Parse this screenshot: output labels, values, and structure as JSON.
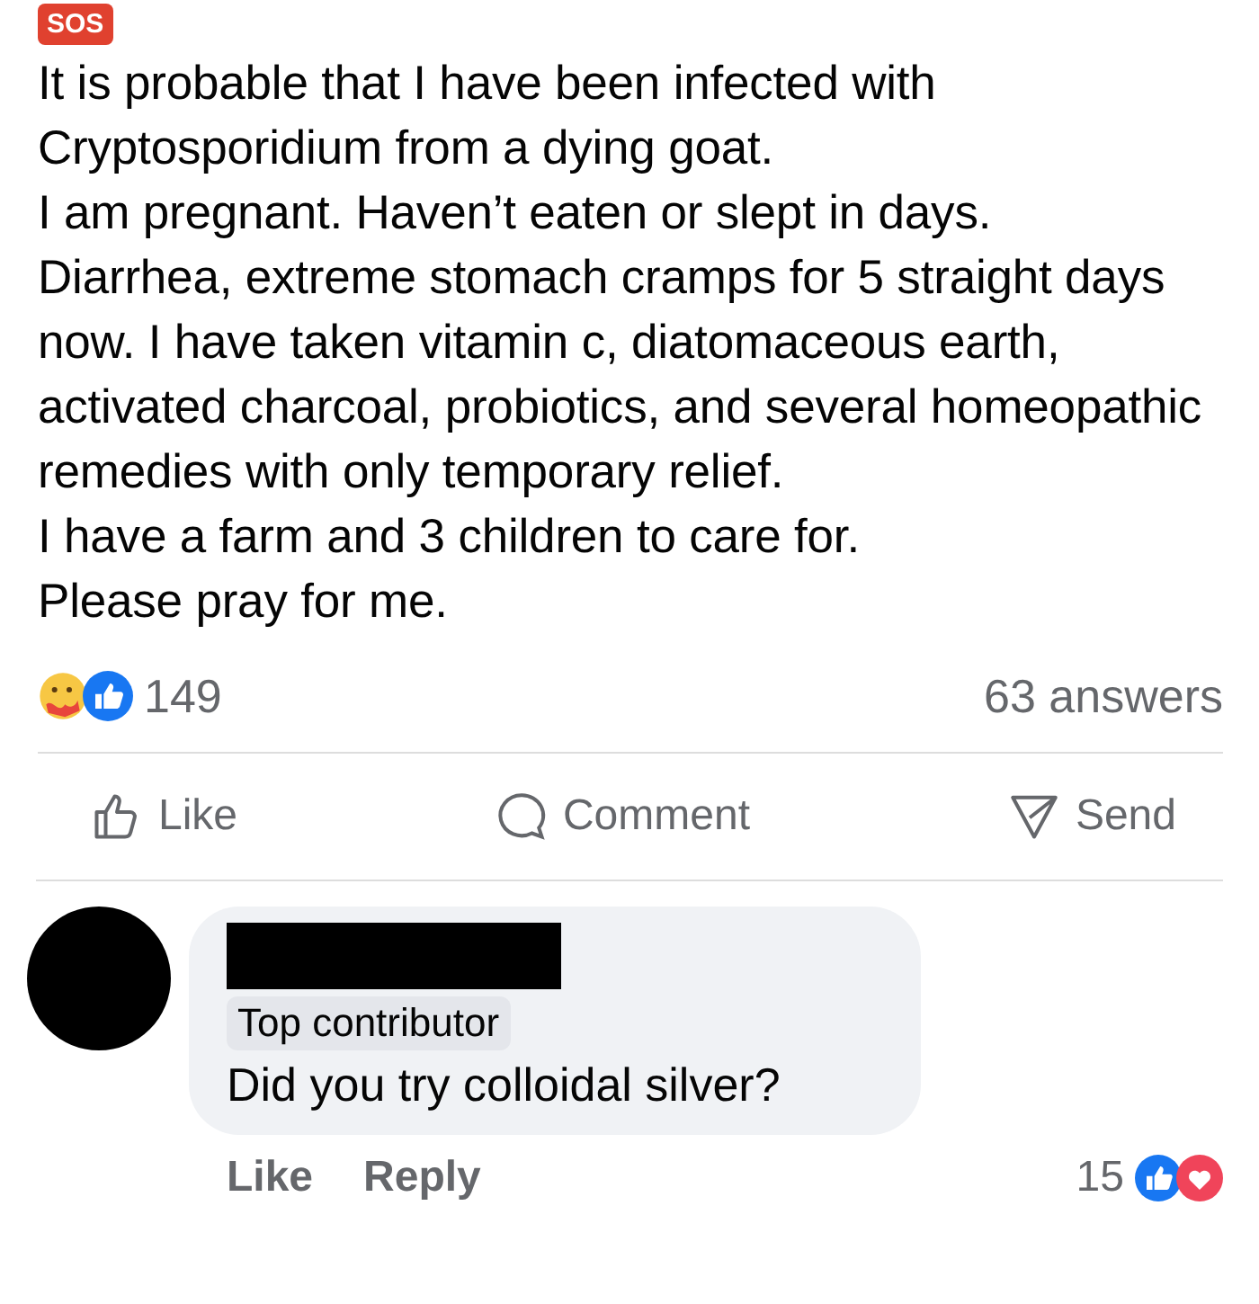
{
  "post": {
    "badge": "SOS",
    "paragraphs": [
      "It is probable that I have been infected with Cryptosporidium from a dying goat.",
      "I am pregnant. Haven’t eaten or slept in days.",
      "Diarrhea, extreme stomach cramps for 5 straight days now. I have taken vitamin c, diatomaceous earth, activated charcoal, probiotics, and several homeopathic remedies with only temporary relief.",
      "I have a farm and 3 children to care for.",
      "Please pray for me."
    ],
    "reaction_count": "149",
    "answers": "63 answers",
    "actions": [
      {
        "kind": "like",
        "label": "Like"
      },
      {
        "kind": "comment",
        "label": "Comment"
      },
      {
        "kind": "send",
        "label": "Send"
      }
    ]
  },
  "comment": {
    "badge": "Top contributor",
    "text": "Did you try colloidal silver?",
    "actions": [
      "Like",
      "Reply"
    ],
    "reaction_count": "15"
  }
}
